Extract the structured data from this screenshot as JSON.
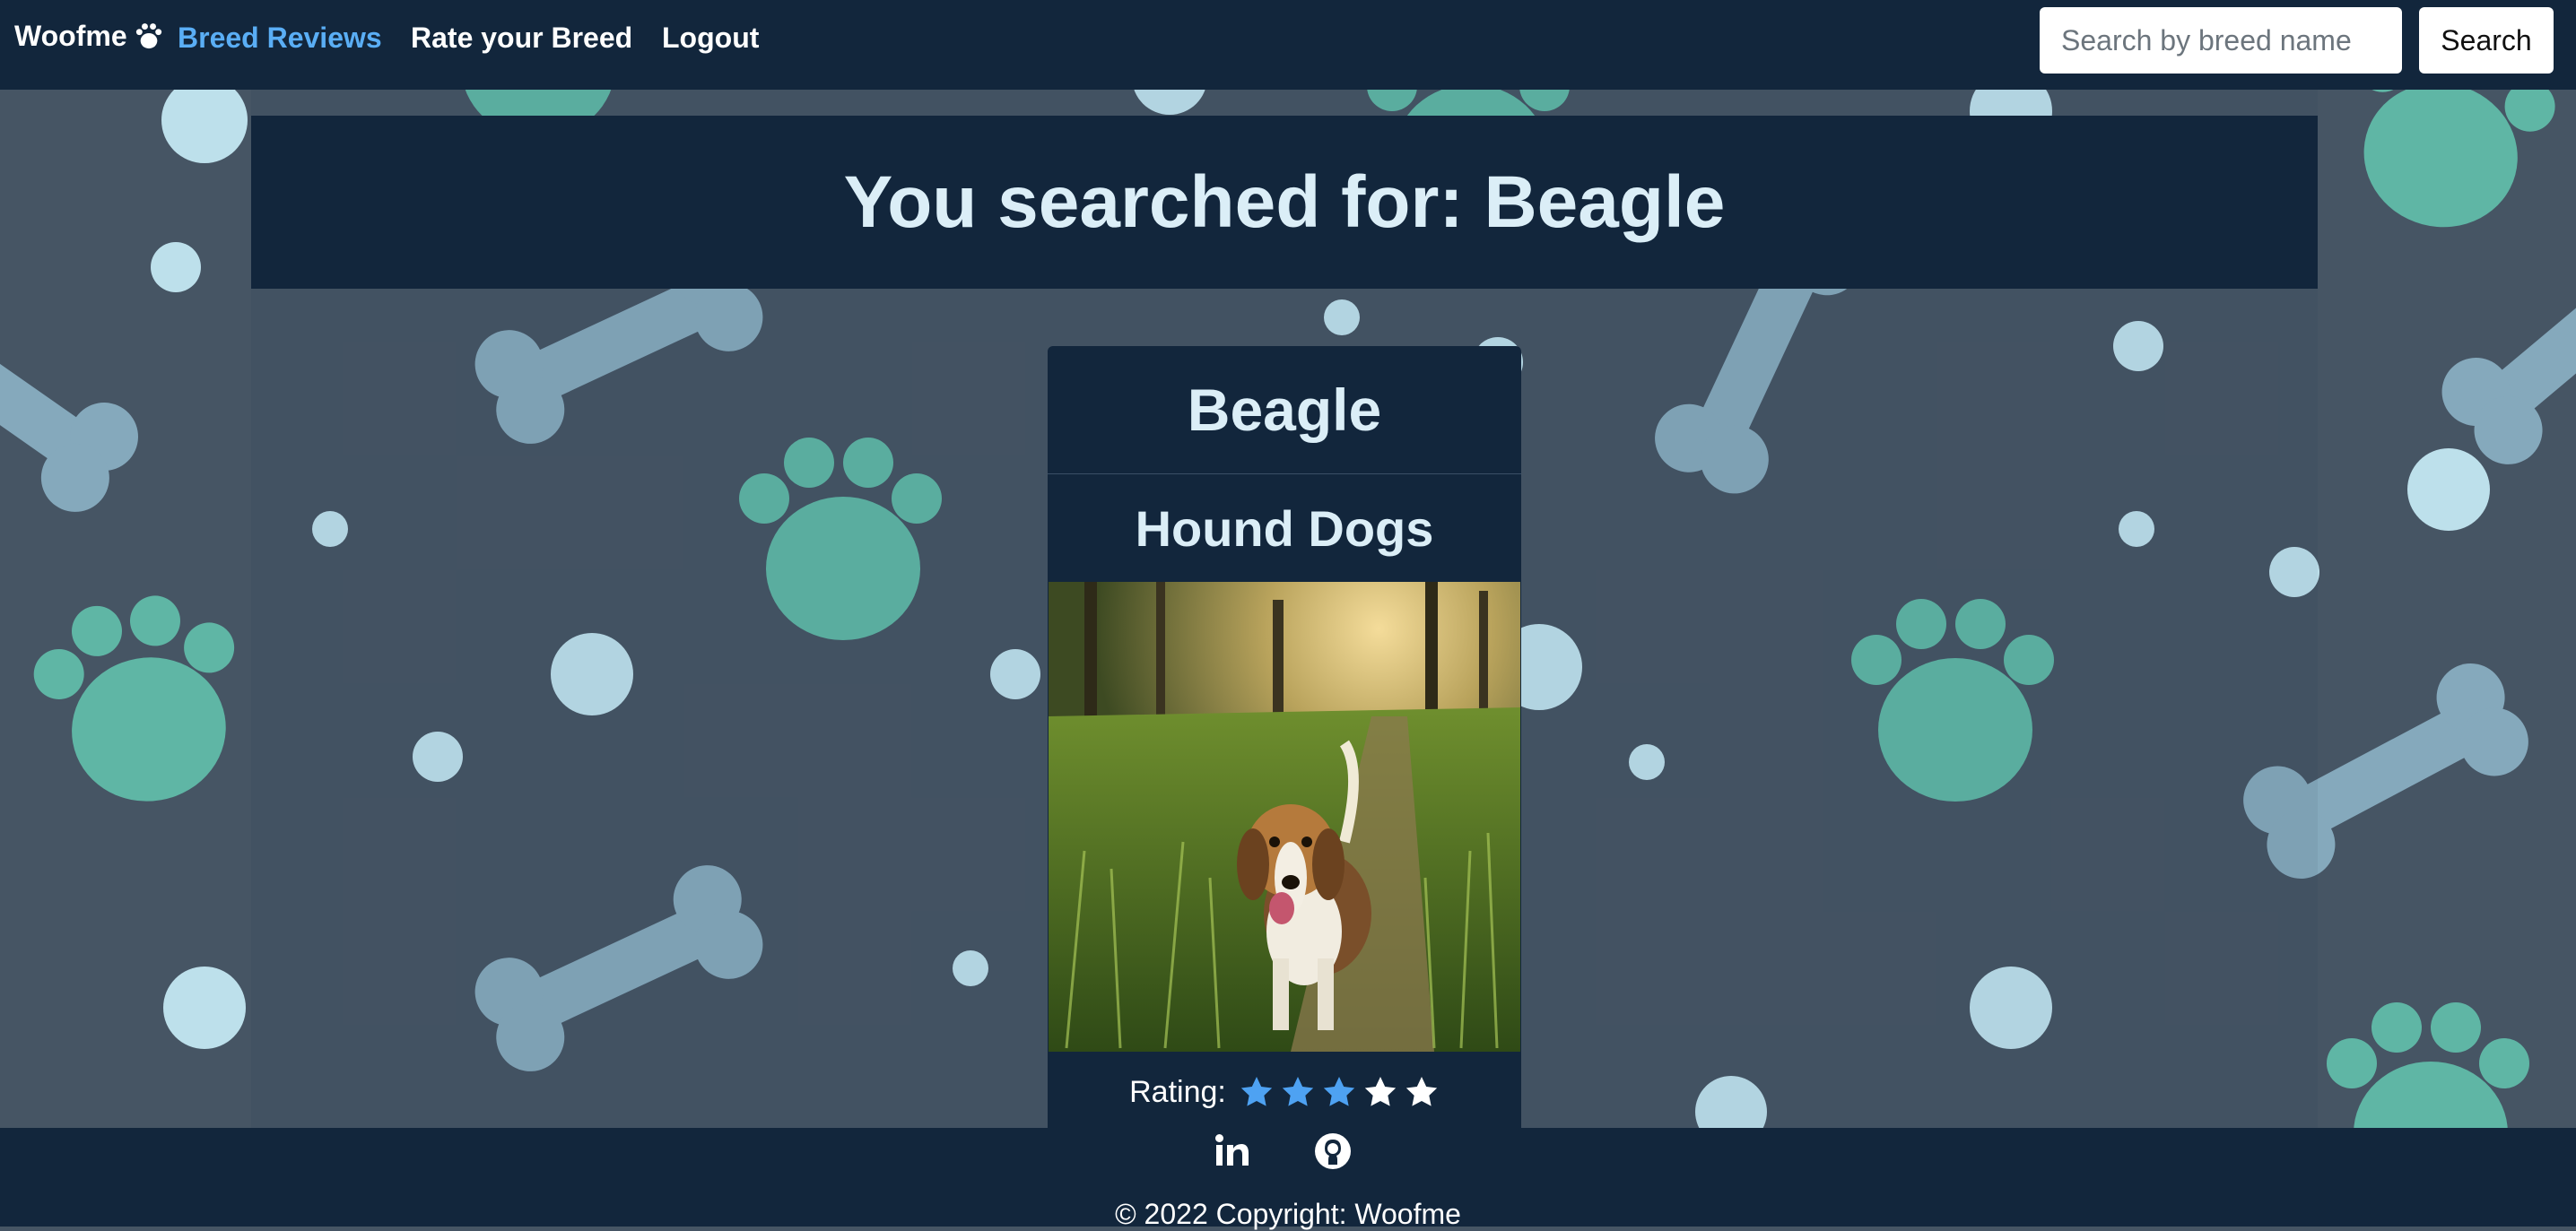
{
  "navbar": {
    "brand": "Woofme",
    "brand_icon": "paw-icon",
    "links": [
      {
        "label": "Breed Reviews",
        "active": true
      },
      {
        "label": "Rate your Breed",
        "active": false
      },
      {
        "label": "Logout",
        "active": false
      }
    ],
    "search_placeholder": "Search by breed name",
    "search_button": "Search"
  },
  "main": {
    "heading": "You searched for: Beagle"
  },
  "card": {
    "breed": "Beagle",
    "group": "Hound Dogs",
    "photo": "beagle-photo",
    "rating_label": "Rating:",
    "rating": 3,
    "rating_max": 5
  },
  "footer": {
    "social_icons": [
      "linkedin-icon",
      "github-icon"
    ],
    "copyright": "© 2022 Copyright: Woofme"
  },
  "colors": {
    "navbar_bg": "#12263c",
    "accent": "#5aaef5",
    "page_bg": "#465564",
    "paw": "#5fb6a5",
    "bone": "#85a9bc",
    "dot": "#bde0eb",
    "star_filled": "#4ea2f2",
    "star_empty": "#ffffff"
  }
}
